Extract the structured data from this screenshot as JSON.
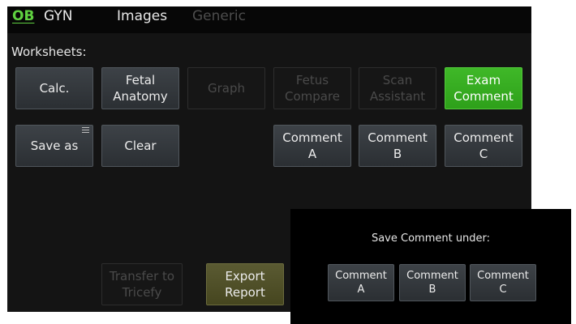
{
  "tabs": {
    "ob": "OB",
    "gyn": "GYN",
    "images": "Images",
    "generic": "Generic"
  },
  "worksheets_label": "Worksheets:",
  "buttons": {
    "calc": "Calc.",
    "fetal_anatomy": "Fetal\nAnatomy",
    "graph": "Graph",
    "fetus_compare": "Fetus\nCompare",
    "scan_assistant": "Scan\nAssistant",
    "exam_comment": "Exam\nComment",
    "save_as": "Save as",
    "clear": "Clear",
    "comment_a": "Comment\nA",
    "comment_b": "Comment\nB",
    "comment_c": "Comment\nC",
    "transfer_tricefy": "Transfer to\nTricefy",
    "export_report": "Export\nReport"
  },
  "dialog": {
    "title": "Save Comment under:",
    "comment_a": "Comment\nA",
    "comment_b": "Comment\nB",
    "comment_c": "Comment\nC"
  },
  "colors": {
    "active_tab": "#5fd140",
    "exam_comment_button": "#36aa1f",
    "export_button": "#505028"
  },
  "icons": {
    "save_as_menu": "menu-icon"
  }
}
